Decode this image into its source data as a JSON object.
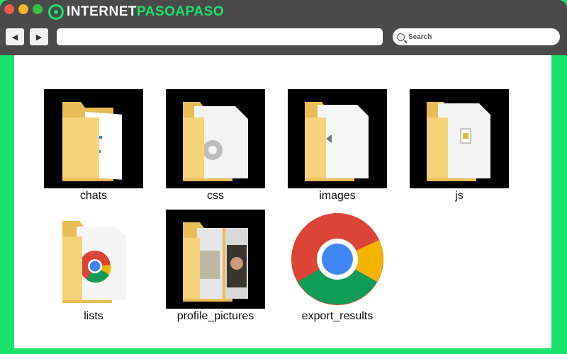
{
  "window": {
    "logo_prefix": "INTERNET",
    "logo_accent": "PASOAPASO",
    "back_icon": "◀",
    "forward_icon": "▶",
    "search_placeholder": "Search"
  },
  "files": [
    {
      "name": "chats",
      "type": "folder",
      "icon": "folder-document-icon"
    },
    {
      "name": "css",
      "type": "folder",
      "icon": "folder-settings-icon"
    },
    {
      "name": "images",
      "type": "folder",
      "icon": "folder-document-icon"
    },
    {
      "name": "js",
      "type": "folder",
      "icon": "folder-script-icon"
    },
    {
      "name": "lists",
      "type": "folder",
      "icon": "folder-chrome-icon"
    },
    {
      "name": "profile_pictures",
      "type": "folder",
      "icon": "folder-photos-icon"
    },
    {
      "name": "export_results",
      "type": "file",
      "icon": "chrome-icon"
    }
  ],
  "colors": {
    "frame": "#1be26a",
    "window_chrome": "#4a4a4a",
    "folder": "#f6d27a",
    "folder_dark": "#e8bd55"
  }
}
